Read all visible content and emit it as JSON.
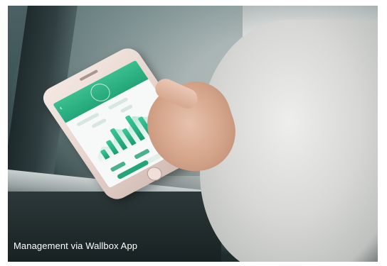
{
  "caption": "Management via Wallbox App"
}
